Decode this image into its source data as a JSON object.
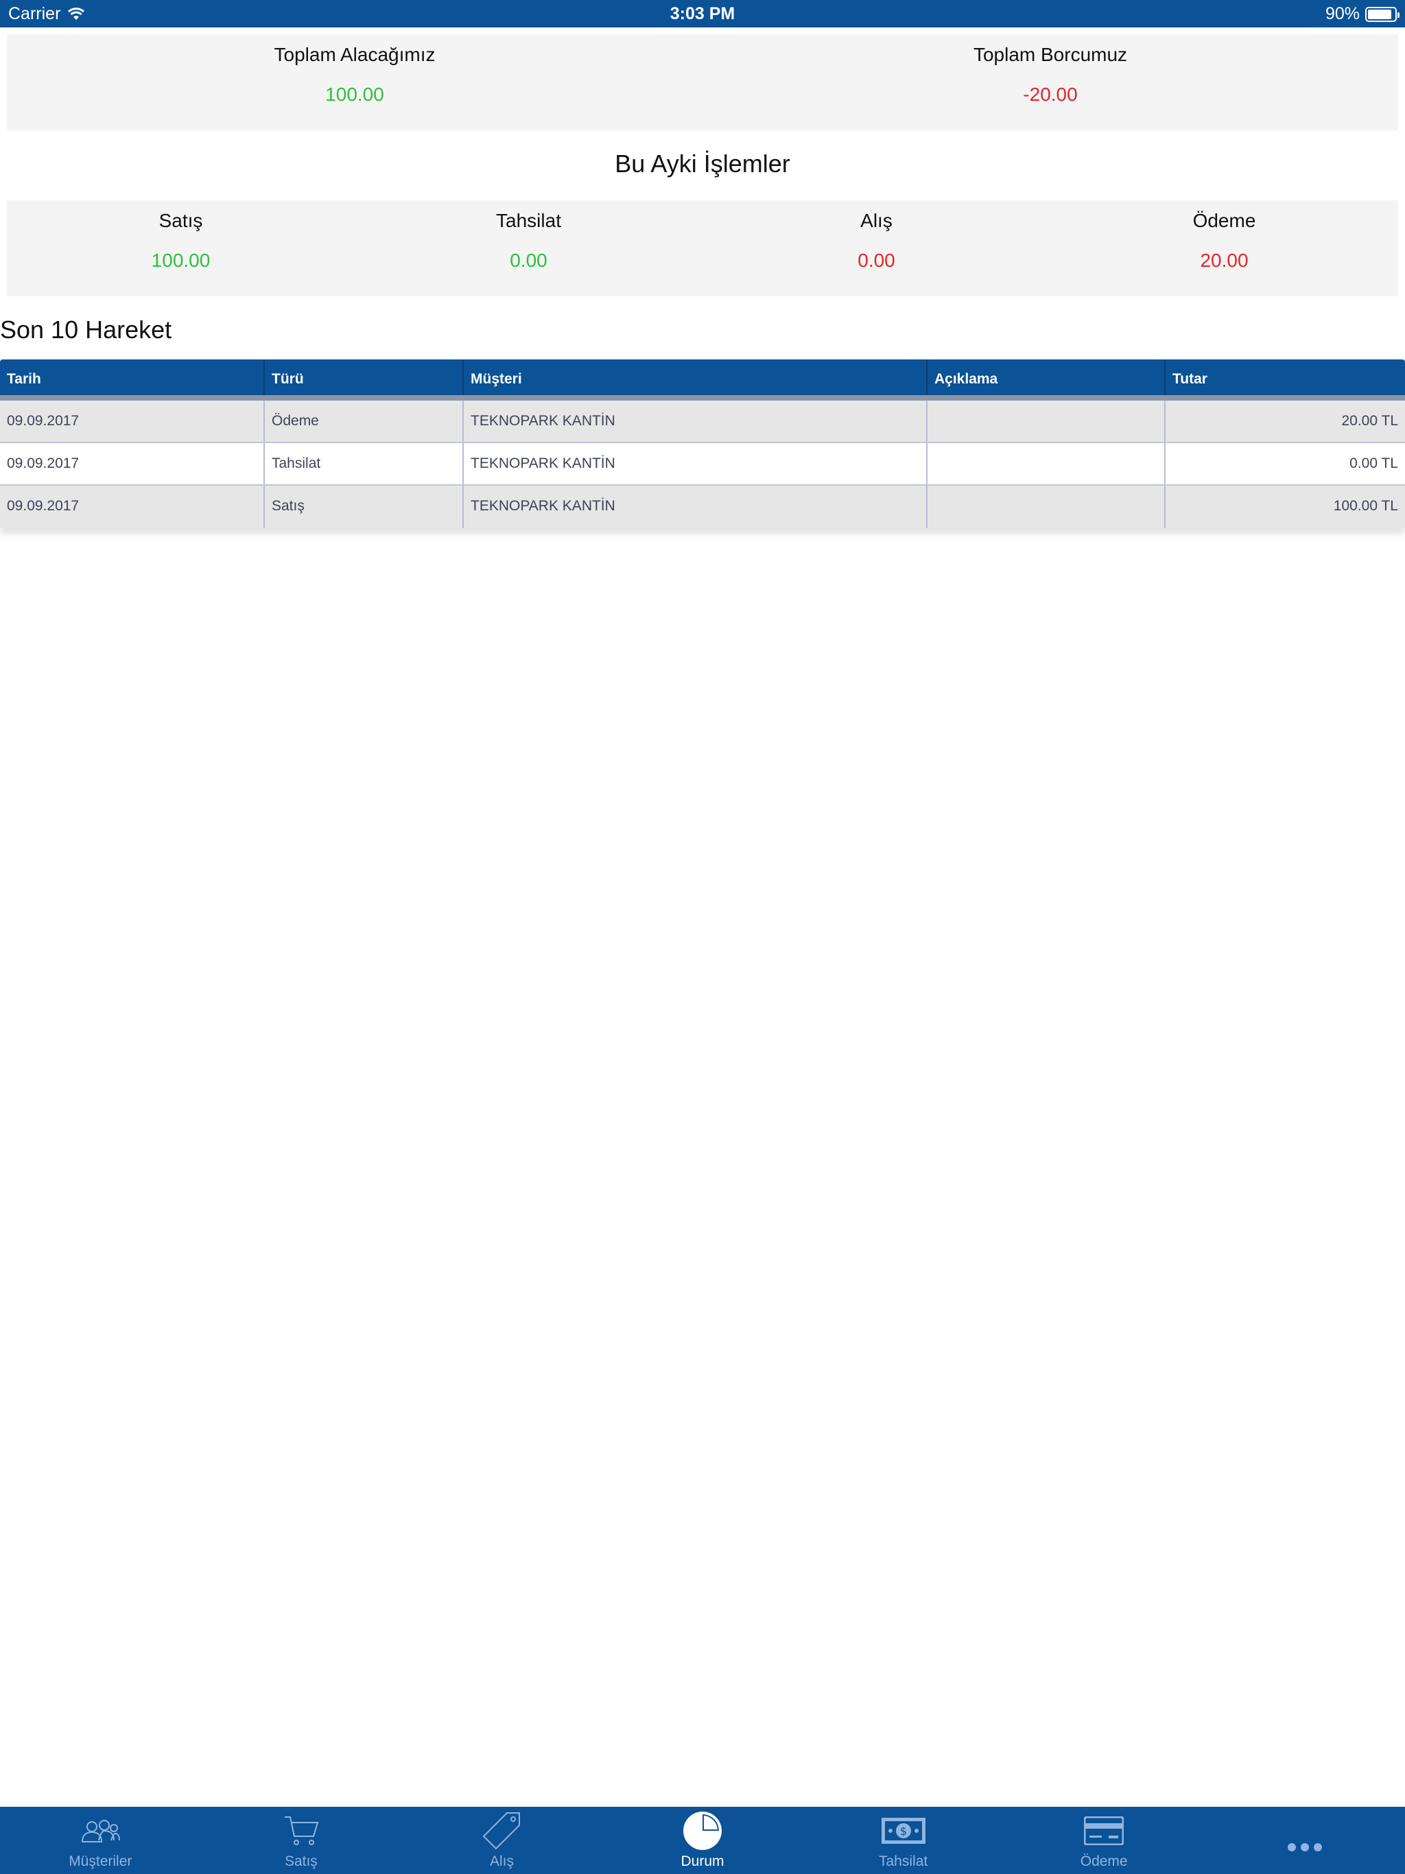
{
  "status_bar": {
    "carrier": "Carrier",
    "time": "3:03 PM",
    "battery": "90%",
    "battery_level": 0.9
  },
  "totals": {
    "receivable_label": "Toplam Alacağımız",
    "receivable_value": "100.00",
    "payable_label": "Toplam Borcumuz",
    "payable_value": "-20.00"
  },
  "month": {
    "title": "Bu Ayki İşlemler",
    "items": [
      {
        "label": "Satış",
        "value": "100.00"
      },
      {
        "label": "Tahsilat",
        "value": "0.00"
      },
      {
        "label": "Alış",
        "value": "0.00"
      },
      {
        "label": "Ödeme",
        "value": "20.00"
      }
    ]
  },
  "recent": {
    "title": "Son 10 Hareket",
    "columns": [
      "Tarih",
      "Türü",
      "Müşteri",
      "Açıklama",
      "Tutar"
    ],
    "rows": [
      [
        "09.09.2017",
        "Ödeme",
        "TEKNOPARK KANTİN",
        "",
        "20.00 TL"
      ],
      [
        "09.09.2017",
        "Tahsilat",
        "TEKNOPARK KANTİN",
        "",
        "0.00 TL"
      ],
      [
        "09.09.2017",
        "Satış",
        "TEKNOPARK KANTİN",
        "",
        "100.00 TL"
      ]
    ]
  },
  "tabs": [
    {
      "label": "Müşteriler",
      "icon": "customers-icon"
    },
    {
      "label": "Satış",
      "icon": "cart-icon"
    },
    {
      "label": "Alış",
      "icon": "tag-icon"
    },
    {
      "label": "Durum",
      "icon": "pie-chart-icon",
      "active": true
    },
    {
      "label": "Tahsilat",
      "icon": "cash-icon"
    },
    {
      "label": "Ödeme",
      "icon": "credit-card-icon"
    },
    {
      "label": "",
      "icon": "more-icon"
    }
  ],
  "colors": {
    "brand": "#0b5296",
    "positive": "#2fbf3e",
    "negative": "#e2262a",
    "tab_inactive": "#8fb5e2"
  }
}
